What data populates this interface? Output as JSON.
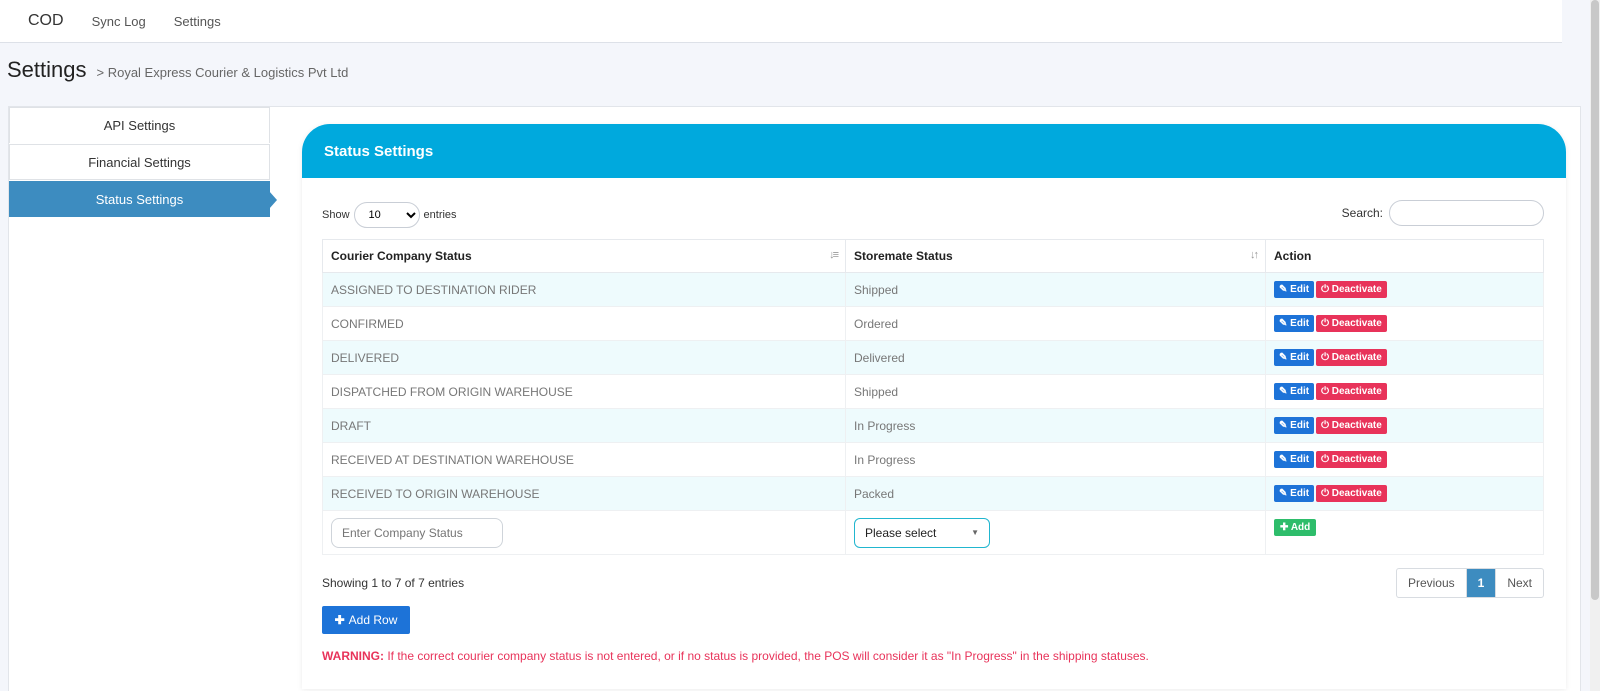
{
  "topnav": {
    "brand": "COD",
    "links": [
      "Sync Log",
      "Settings"
    ]
  },
  "header": {
    "title": "Settings",
    "subtitle": "> Royal Express Courier & Logistics Pvt Ltd"
  },
  "sidebar": {
    "items": [
      {
        "label": "API Settings"
      },
      {
        "label": "Financial Settings"
      },
      {
        "label": "Status Settings",
        "active": true
      }
    ]
  },
  "card": {
    "title": "Status Settings"
  },
  "table_controls": {
    "show_label": "Show",
    "entries_value": "10",
    "entries_label": "entries",
    "search_label": "Search:"
  },
  "table": {
    "columns": [
      "Courier Company Status",
      "Storemate Status",
      "Action"
    ],
    "edit_label": "Edit",
    "deactivate_label": "Deactivate",
    "rows": [
      {
        "courier": "ASSIGNED TO DESTINATION RIDER",
        "storemate": "Shipped"
      },
      {
        "courier": "CONFIRMED",
        "storemate": "Ordered"
      },
      {
        "courier": "DELIVERED",
        "storemate": "Delivered"
      },
      {
        "courier": "DISPATCHED FROM ORIGIN WAREHOUSE",
        "storemate": "Shipped"
      },
      {
        "courier": "DRAFT",
        "storemate": "In Progress"
      },
      {
        "courier": "RECEIVED AT DESTINATION WAREHOUSE",
        "storemate": "In Progress"
      },
      {
        "courier": "RECEIVED TO ORIGIN WAREHOUSE",
        "storemate": "Packed"
      }
    ],
    "new_row": {
      "company_placeholder": "Enter Company Status",
      "select_value": "Please select",
      "add_label": "Add"
    }
  },
  "footer": {
    "info": "Showing 1 to 7 of 7 entries",
    "prev": "Previous",
    "page": "1",
    "next": "Next",
    "add_row": "Add Row",
    "warning_label": "WARNING:",
    "warning_text": " If the correct courier company status is not entered, or if no status is provided, the POS will consider it as \"In Progress\" in the shipping statuses."
  }
}
